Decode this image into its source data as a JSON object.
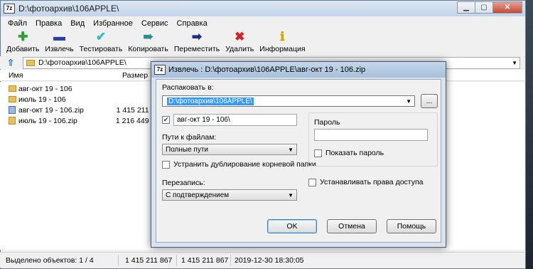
{
  "window": {
    "icon_text": "7z",
    "title": "D:\\фотоархив\\106APPLE\\"
  },
  "menu": [
    "Файл",
    "Правка",
    "Вид",
    "Избранное",
    "Сервис",
    "Справка"
  ],
  "toolbar": [
    {
      "label": "Добавить",
      "icon": "plus-icon",
      "glyph": "✚",
      "color": "#2da12d"
    },
    {
      "label": "Извлечь",
      "icon": "minus-icon",
      "glyph": "▬",
      "color": "#2a3fa8"
    },
    {
      "label": "Тестировать",
      "icon": "check-icon",
      "glyph": "✔",
      "color": "#2bbcc8"
    },
    {
      "label": "Копировать",
      "icon": "copy-arrow-icon",
      "glyph": "➠",
      "color": "#2a8f8f"
    },
    {
      "label": "Переместить",
      "icon": "move-arrow-icon",
      "glyph": "➡",
      "color": "#1e2f8a"
    },
    {
      "label": "Удалить",
      "icon": "delete-icon",
      "glyph": "✖",
      "color": "#d62020"
    },
    {
      "label": "Информация",
      "icon": "info-icon",
      "glyph": "ℹ",
      "color": "#c9a800"
    }
  ],
  "address": {
    "path": "D:\\фотоархив\\106APPLE\\"
  },
  "list": {
    "columns": {
      "name": "Имя",
      "size": "Размер"
    },
    "rows": [
      {
        "name": "авг-окт 19 - 106",
        "size": "",
        "type": "folder"
      },
      {
        "name": "июль 19 - 106",
        "size": "",
        "type": "folder"
      },
      {
        "name": "авг-окт 19 - 106.zip",
        "size": "1 415 211 867",
        "type": "zip"
      },
      {
        "name": "июль 19 - 106.zip",
        "size": "1 216 449 037",
        "type": "zip-yellow"
      }
    ]
  },
  "status": {
    "selected": "Выделено объектов: 1 / 4",
    "size1": "1 415 211 867",
    "size2": "1 415 211 867",
    "datetime": "2019-12-30 18:30:05"
  },
  "dialog": {
    "title": "Извлечь : D:\\фотоархив\\106APPLE\\авг-окт 19 - 106.zip",
    "extract_to_label": "Распаковать в:",
    "extract_to_value": "D:\\фотоархив\\106APPLE\\",
    "browse_label": "...",
    "subfolder_checked": true,
    "subfolder_value": "авг-окт 19 - 106\\",
    "paths_label": "Пути к файлам:",
    "paths_value": "Полные пути",
    "eliminate_root_label": "Устранить дублирование корневой папки",
    "eliminate_root_checked": false,
    "overwrite_label": "Перезапись:",
    "overwrite_value": "С подтверждением",
    "password_label": "Пароль",
    "password_value": "",
    "show_password_label": "Показать пароль",
    "show_password_checked": false,
    "set_access_label": "Устанавливать права доступа",
    "set_access_checked": false,
    "ok_label": "OK",
    "cancel_label": "Отмена",
    "help_label": "Помощь"
  }
}
